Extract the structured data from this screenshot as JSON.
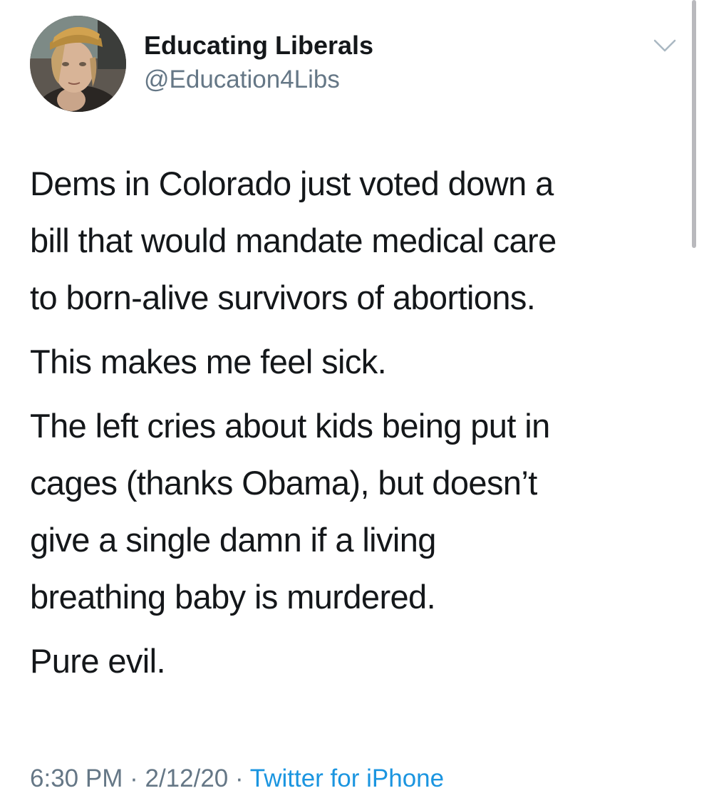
{
  "user": {
    "display_name": "Educating Liberals",
    "handle": "@Education4Libs"
  },
  "tweet": {
    "paragraphs": [
      "Dems in Colorado just voted down a\nbill that would mandate medical care\nto born-alive survivors of abortions.",
      "This makes me feel sick.",
      "The left cries about kids being put in\ncages (thanks Obama), but doesn’t\ngive a single damn if a living\nbreathing baby is murdered.",
      "Pure evil."
    ],
    "time": "6:30 PM",
    "date": "2/12/20",
    "separator": "·",
    "source": "Twitter for iPhone"
  },
  "icons": {
    "menu": "chevron-down-icon",
    "avatar": "profile-avatar"
  },
  "colors": {
    "text": "#14171a",
    "secondary": "#657786",
    "link": "#1b95e0"
  }
}
